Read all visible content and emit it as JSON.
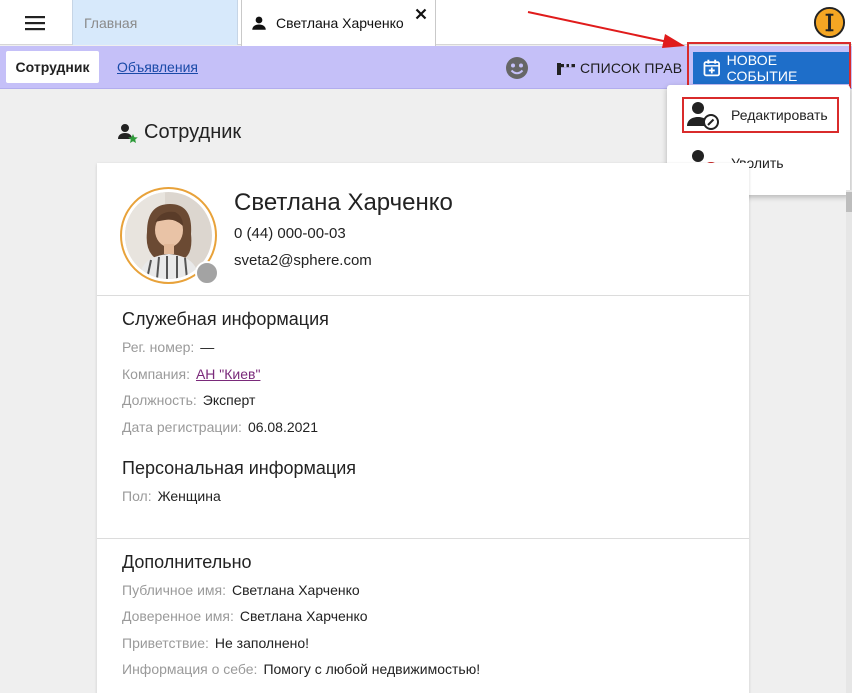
{
  "tabs": {
    "home": "Главная",
    "active": "Светлана Харченко"
  },
  "toolbar": {
    "employee_chip": "Сотрудник",
    "ads_link": "Объявления",
    "rights_button": "СПИСОК ПРАВ",
    "new_event_button": "НОВОЕ СОБЫТИЕ"
  },
  "menu": {
    "items": [
      {
        "label": "Редактировать",
        "icon": "user-edit-icon"
      },
      {
        "label": "Уволить",
        "icon": "user-remove-icon"
      }
    ]
  },
  "page": {
    "title": "Сотрудник"
  },
  "profile": {
    "name": "Светлана Харченко",
    "phone": "0 (44) 000-00-03",
    "email": "sveta2@sphere.com"
  },
  "service_info": {
    "title": "Служебная информация",
    "reg_number": {
      "label": "Рег. номер:",
      "value": "—"
    },
    "company": {
      "label": "Компания:",
      "value": "АН \"Киев\""
    },
    "position": {
      "label": "Должность:",
      "value": "Эксперт"
    },
    "reg_date": {
      "label": "Дата регистрации:",
      "value": "06.08.2021"
    }
  },
  "personal_info": {
    "title": "Персональная информация",
    "gender": {
      "label": "Пол:",
      "value": "Женщина"
    }
  },
  "extra_info": {
    "title": "Дополнительно",
    "public_name": {
      "label": "Публичное имя:",
      "value": "Светлана Харченко"
    },
    "trusted_name": {
      "label": "Доверенное имя:",
      "value": "Светлана Харченко"
    },
    "greeting": {
      "label": "Приветствие:",
      "value": "Не заполнено!"
    },
    "about": {
      "label": "Информация о себе:",
      "value": "Помогу с любой недвижимостью!"
    }
  },
  "colors": {
    "toolbar_bg": "#c5c0f8",
    "primary_button": "#1e6ec9",
    "highlight": "#d92b2b",
    "avatar_ring": "#e8a23a",
    "home_tab": "#d7e9fb"
  }
}
